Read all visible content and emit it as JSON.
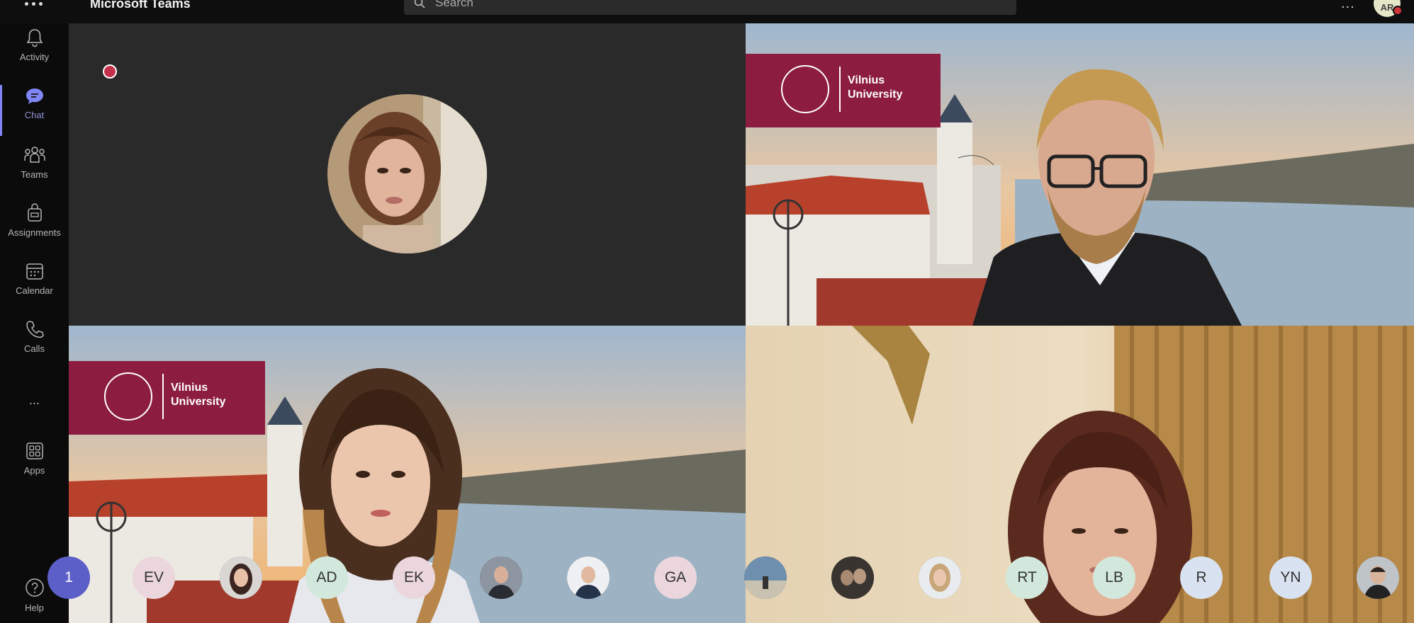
{
  "topbar": {
    "app_title": "Microsoft Teams",
    "search_placeholder": "Search",
    "more_label": "...",
    "user_initials": "AR"
  },
  "rail": {
    "items": [
      {
        "label": "Activity",
        "icon": "bell-icon"
      },
      {
        "label": "Chat",
        "icon": "chat-icon",
        "active": true
      },
      {
        "label": "Teams",
        "icon": "teams-icon"
      },
      {
        "label": "Assignments",
        "icon": "assignments-icon"
      },
      {
        "label": "Calendar",
        "icon": "calendar-icon"
      },
      {
        "label": "Calls",
        "icon": "phone-icon"
      },
      {
        "label": "...",
        "icon": "more-icon"
      },
      {
        "label": "Apps",
        "icon": "apps-icon"
      },
      {
        "label": "Help",
        "icon": "help-icon"
      }
    ]
  },
  "tiles": {
    "banner_name_line1": "Vilnius",
    "banner_name_line2": "University"
  },
  "participants": {
    "partial_count": "1",
    "avatars": [
      {
        "type": "initials",
        "text": "EV",
        "color": "#ead6dc"
      },
      {
        "type": "photo",
        "icon": "participant-photo"
      },
      {
        "type": "initials",
        "text": "AD",
        "color": "#d2e8dc"
      },
      {
        "type": "initials",
        "text": "EK",
        "color": "#ead6dc"
      },
      {
        "type": "photo",
        "icon": "participant-photo"
      },
      {
        "type": "photo",
        "icon": "participant-photo"
      },
      {
        "type": "initials",
        "text": "GA",
        "color": "#ead6dc"
      },
      {
        "type": "photo",
        "icon": "participant-photo"
      },
      {
        "type": "photo",
        "icon": "participant-photo"
      },
      {
        "type": "photo",
        "icon": "participant-photo"
      },
      {
        "type": "initials",
        "text": "RT",
        "color": "#d2e8dc"
      },
      {
        "type": "initials",
        "text": "LB",
        "color": "#d2e8dc"
      },
      {
        "type": "initials",
        "text": "R",
        "color": "#d8e2f0"
      },
      {
        "type": "initials",
        "text": "YN",
        "color": "#d8e2f0"
      },
      {
        "type": "photo",
        "icon": "participant-photo"
      }
    ]
  }
}
